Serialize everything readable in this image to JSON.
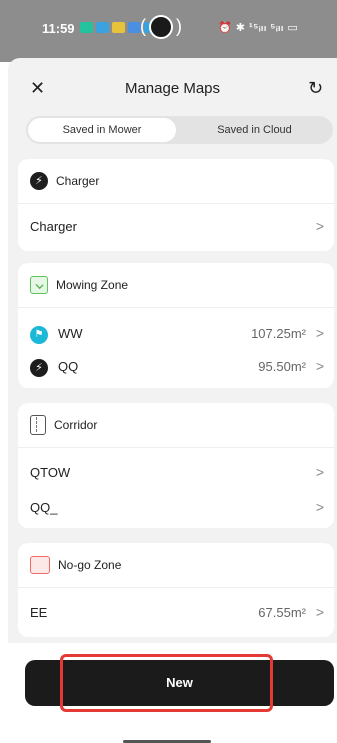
{
  "status_bar": {
    "time": "11:59",
    "right_text": "⏰ ✱ ¹⁵ᵢₗₗ ⁵ᵢₗₗ ▭"
  },
  "header": {
    "close_label": "✕",
    "title": "Manage Maps",
    "refresh_label": "↻"
  },
  "tabs": {
    "saved_in_mower": "Saved in Mower",
    "saved_in_cloud": "Saved in Cloud"
  },
  "sections": {
    "charger": {
      "title": "Charger",
      "items": [
        {
          "name": "Charger"
        }
      ]
    },
    "mowing_zone": {
      "title": "Mowing Zone",
      "items": [
        {
          "name": "WW",
          "value": "107.25m²"
        },
        {
          "name": "QQ",
          "value": "95.50m²"
        }
      ]
    },
    "corridor": {
      "title": "Corridor",
      "items": [
        {
          "name": "QTOW"
        },
        {
          "name": "QQ_"
        }
      ]
    },
    "no_go_zone": {
      "title": "No-go Zone",
      "items": [
        {
          "name": "EE",
          "value": "67.55m²"
        }
      ]
    }
  },
  "actions": {
    "new_label": "New"
  },
  "chevron": ">",
  "colors": {
    "accent_teal": "#1bb8d8",
    "zone_green": "#5cc25c",
    "nogo_red": "#ef6b6b",
    "highlight_red": "#e53935",
    "button_dark": "#1b1b1b"
  }
}
